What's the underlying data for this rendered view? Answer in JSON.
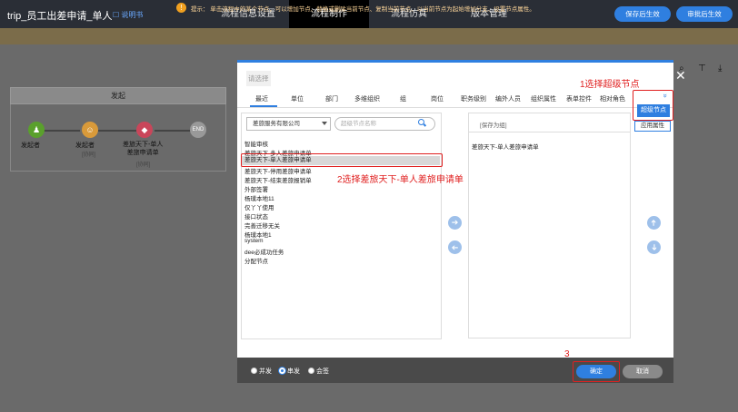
{
  "app": {
    "title": "trip_员工出差申请_单人",
    "manual": "说明书"
  },
  "nav": [
    "流程信息设置",
    "流程制作",
    "流程仿真",
    "版本管理"
  ],
  "top_buttons": {
    "save": "保存后生效",
    "approve": "审批后生效"
  },
  "notice": {
    "icon": "!",
    "text": "提示： 单击流程中的某个节点，可以增加节点、替换或删除当前节点、复制当前节点、以当前节点为起始增加分支、设置节点属性。"
  },
  "flow": {
    "header": "发起",
    "nodes": [
      {
        "label": "发起者",
        "sub": ""
      },
      {
        "label": "发起者",
        "sub": "[协同]"
      },
      {
        "label": "差旅天下-单人\n差旅申请单",
        "sub": "[协同]"
      },
      {
        "label": "END",
        "sub": ""
      }
    ]
  },
  "modal": {
    "title": "请选择",
    "tabs": [
      "最近",
      "单位",
      "部门",
      "多维组织",
      "组",
      "岗位",
      "职务级别",
      "编外人员",
      "组织属性",
      "表单控件",
      "相对角色"
    ],
    "more_icon": "»",
    "super_node": "超级节点",
    "apply_attr": "应用属性",
    "org_select": "差旅服务有限公司",
    "search_placeholder": "超级节点名称",
    "items": [
      "智能审核",
      "差旅天下-多人差旅申请单",
      "差旅天下-单人差旅申请单",
      "差旅天下-停用差旅申请单",
      "差旅天下-结束差旅报销单",
      "外部签署",
      "杨璞本地11",
      "仅丫丫使用",
      "接口状态",
      "完善迁移无关",
      "杨璞本地1",
      "system",
      "dee必成功任务",
      "分配节点"
    ],
    "right_header": "[保存为组]",
    "right_items": [
      "差旅天下-单人差旅申请单"
    ],
    "arrows": {
      "add": "➔",
      "remove": "➔",
      "up": "➔",
      "down": "➔"
    },
    "close": "✕",
    "radios": [
      "并发",
      "串发",
      "会签"
    ],
    "confirm": "确定",
    "cancel": "取消"
  },
  "annotations": {
    "a1": "1选择超级节点",
    "a2": "2选择差旅天下-单人差旅申请单",
    "a3": "3"
  },
  "colors": {
    "accent": "#2f7fe0",
    "annotation": "#e02020"
  }
}
